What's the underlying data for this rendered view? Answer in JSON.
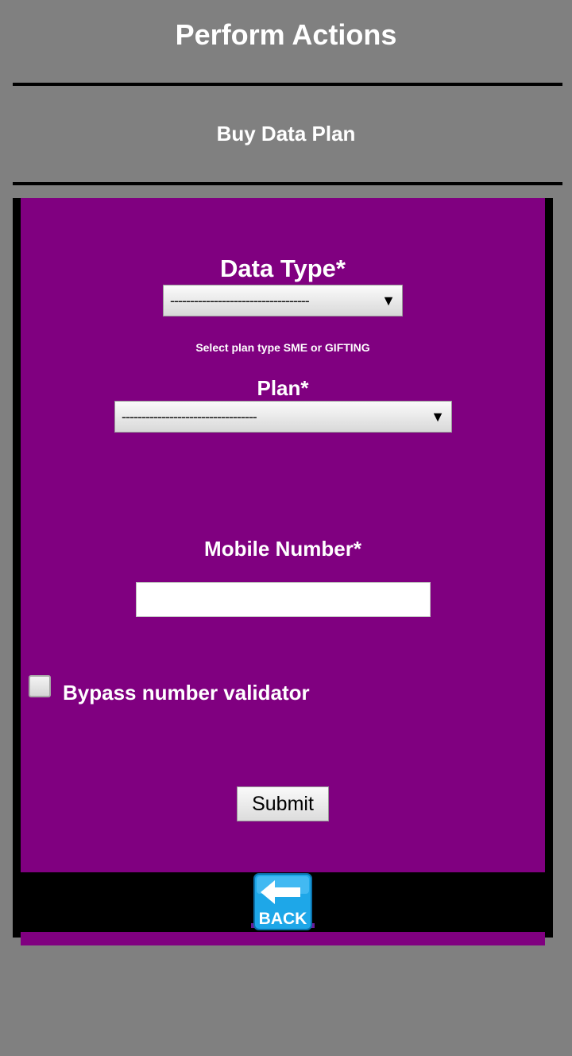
{
  "header": {
    "title": "Perform Actions",
    "subtitle": "Buy Data Plan"
  },
  "form": {
    "data_type": {
      "label": "Data Type*",
      "selected": "-----------------------------------",
      "hint": "Select plan type SME or GIFTING"
    },
    "plan": {
      "label": "Plan*",
      "selected": "----------------------------------"
    },
    "mobile": {
      "label": "Mobile Number*",
      "value": ""
    },
    "bypass": {
      "label": "Bypass number validator",
      "checked": false
    },
    "submit_label": "Submit"
  },
  "back": {
    "label": "BACK",
    "icon": "back-arrow-icon"
  },
  "colors": {
    "background": "#808080",
    "panel": "#800080",
    "frame": "#000000",
    "back_icon": "#1ea7e8"
  }
}
